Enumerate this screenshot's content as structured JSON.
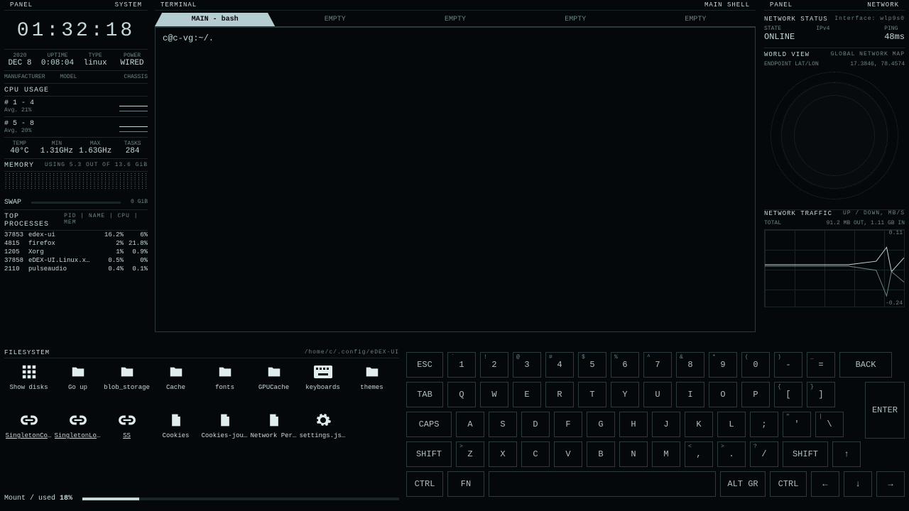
{
  "header": {
    "left_a": "PANEL",
    "left_b": "SYSTEM",
    "mid_a": "TERMINAL",
    "mid_b": "MAIN SHELL",
    "right_a": "PANEL",
    "right_b": "NETWORK"
  },
  "clock": "01:32:18",
  "date": {
    "year": "2020",
    "day": "DEC 8",
    "uptime_l": "UPTIME",
    "uptime": "0:08:04",
    "type_l": "TYPE",
    "type": "linux",
    "power_l": "POWER",
    "power": "WIRED"
  },
  "hw": {
    "mfr": "MANUFACTURER",
    "model": "MODEL",
    "chassis": "CHASSIS"
  },
  "cpu": {
    "title": "CPU USAGE",
    "g1_label": "# 1 - 4",
    "g1_avg": "Avg. 21%",
    "g2_label": "# 5 - 8",
    "g2_avg": "Avg. 20%",
    "temp_l": "TEMP",
    "temp": "40°C",
    "min_l": "MIN",
    "min": "1.31GHz",
    "max_l": "MAX",
    "max": "1.63GHz",
    "tasks_l": "TASKS",
    "tasks": "284"
  },
  "mem": {
    "title": "MEMORY",
    "usage": "USING 5.3 OUT OF 13.6 GiB",
    "swap": "SWAP",
    "swap_val": "0 GiB"
  },
  "top": {
    "title": "TOP PROCESSES",
    "cols": "PID | NAME | CPU | MEM",
    "rows": [
      {
        "pid": "37853",
        "name": "edex-ui",
        "cpu": "16.2%",
        "mem": "6%"
      },
      {
        "pid": "4815",
        "name": "firefox",
        "cpu": "2%",
        "mem": "21.8%"
      },
      {
        "pid": "1205",
        "name": "Xorg",
        "cpu": "1%",
        "mem": "0.9%"
      },
      {
        "pid": "37858",
        "name": "eDEX-UI.Linux.x…",
        "cpu": "0.5%",
        "mem": "0%"
      },
      {
        "pid": "2110",
        "name": "pulseaudio",
        "cpu": "0.4%",
        "mem": "0.1%"
      }
    ]
  },
  "tabs": [
    "MAIN - bash",
    "EMPTY",
    "EMPTY",
    "EMPTY",
    "EMPTY"
  ],
  "terminal": {
    "prompt": "c@c-vg:~/."
  },
  "net": {
    "status_t": "NETWORK STATUS",
    "iface_l": "Interface:",
    "iface": "wlp9s0",
    "state_l": "STATE",
    "state": "ONLINE",
    "ipv4_l": "IPv4",
    "ping_l": "PING",
    "ping": "48ms",
    "world_t": "WORLD VIEW",
    "world_r": "GLOBAL NETWORK MAP",
    "endpoint": "ENDPOINT LAT/LON",
    "coords": "17.3846, 78.4574",
    "traffic_t": "NETWORK TRAFFIC",
    "traffic_r": "UP / DOWN, MB/S",
    "total": "TOTAL",
    "total_v": "91.2 MB OUT, 1.11 GB IN",
    "chart_hi": "0.11",
    "chart_lo": "-0.24"
  },
  "fs": {
    "title": "FILESYSTEM",
    "path": "/home/c/.config/eDEX-UI",
    "items": [
      {
        "label": "Show disks",
        "icon": "grid",
        "ul": false
      },
      {
        "label": "Go up",
        "icon": "folder",
        "ul": false
      },
      {
        "label": "blob_storage",
        "icon": "folder",
        "ul": false
      },
      {
        "label": "Cache",
        "icon": "folder",
        "ul": false
      },
      {
        "label": "fonts",
        "icon": "folder",
        "ul": false
      },
      {
        "label": "GPUCache",
        "icon": "folder",
        "ul": false
      },
      {
        "label": "keyboards",
        "icon": "kbd",
        "ul": false
      },
      {
        "label": "themes",
        "icon": "folder",
        "ul": false
      },
      {
        "label": "SingletonCoo…",
        "icon": "link",
        "ul": true
      },
      {
        "label": "SingletonLock",
        "icon": "link",
        "ul": true
      },
      {
        "label": "SS",
        "icon": "link",
        "ul": true
      },
      {
        "label": "Cookies",
        "icon": "file",
        "ul": false
      },
      {
        "label": "Cookies-jour…",
        "icon": "file",
        "ul": false
      },
      {
        "label": "Network Pers…",
        "icon": "file",
        "ul": false
      },
      {
        "label": "settings.json",
        "icon": "gear",
        "ul": false
      }
    ],
    "mount_l": "Mount / used",
    "mount_v": "18%"
  },
  "kbd": {
    "r1": [
      {
        "k": "ESC"
      },
      {
        "k": "1",
        "s": "`"
      },
      {
        "k": "2",
        "s": "!"
      },
      {
        "k": "3",
        "s": "@"
      },
      {
        "k": "4",
        "s": "#"
      },
      {
        "k": "5",
        "s": "$"
      },
      {
        "k": "6",
        "s": "%"
      },
      {
        "k": "7",
        "s": "^"
      },
      {
        "k": "8",
        "s": "&"
      },
      {
        "k": "9",
        "s": "*"
      },
      {
        "k": "0",
        "s": "("
      },
      {
        "k": "-",
        "s": ")"
      },
      {
        "k": "=",
        "s": "_"
      },
      {
        "k": "BACK"
      }
    ],
    "r2": [
      {
        "k": "TAB"
      },
      {
        "k": "Q"
      },
      {
        "k": "W"
      },
      {
        "k": "E"
      },
      {
        "k": "R"
      },
      {
        "k": "T"
      },
      {
        "k": "Y"
      },
      {
        "k": "U"
      },
      {
        "k": "I"
      },
      {
        "k": "O"
      },
      {
        "k": "P"
      },
      {
        "k": "[",
        "s": "{"
      },
      {
        "k": "]",
        "s": "}"
      }
    ],
    "r3": [
      {
        "k": "CAPS"
      },
      {
        "k": "A"
      },
      {
        "k": "S"
      },
      {
        "k": "D"
      },
      {
        "k": "F"
      },
      {
        "k": "G"
      },
      {
        "k": "H"
      },
      {
        "k": "J"
      },
      {
        "k": "K"
      },
      {
        "k": "L"
      },
      {
        "k": ";"
      },
      {
        "k": "'",
        "s": "\""
      },
      {
        "k": "\\",
        "s": "|"
      }
    ],
    "r4": [
      {
        "k": "SHIFT"
      },
      {
        "k": "Z",
        "s": ">"
      },
      {
        "k": "X"
      },
      {
        "k": "C"
      },
      {
        "k": "V"
      },
      {
        "k": "B"
      },
      {
        "k": "N"
      },
      {
        "k": "M"
      },
      {
        "k": ",",
        "s": "<"
      },
      {
        "k": ".",
        "s": ">"
      },
      {
        "k": "/",
        "s": "?"
      },
      {
        "k": "SHIFT"
      },
      {
        "k": "↑"
      }
    ],
    "r5": [
      {
        "k": "CTRL"
      },
      {
        "k": "FN"
      },
      {
        "k": " "
      },
      {
        "k": "ALT GR"
      },
      {
        "k": "CTRL"
      },
      {
        "k": "←"
      },
      {
        "k": "↓"
      },
      {
        "k": "→"
      }
    ],
    "enter": "ENTER"
  }
}
